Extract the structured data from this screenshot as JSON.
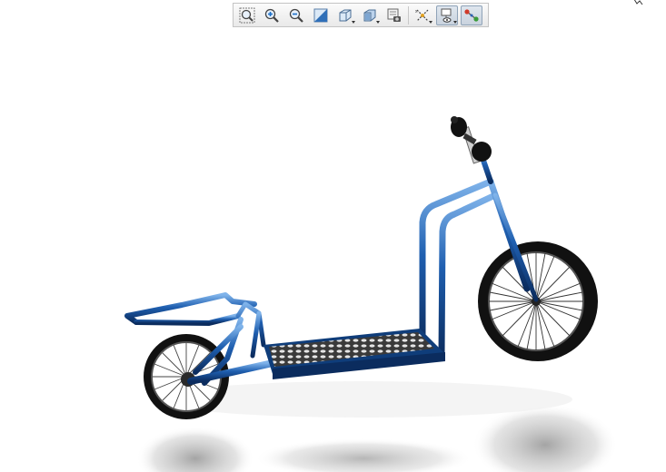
{
  "toolbar": {
    "buttons": [
      {
        "name": "zoom-to-fit",
        "icon": "zoom-fit-icon"
      },
      {
        "name": "zoom-in",
        "icon": "zoom-in-icon"
      },
      {
        "name": "zoom-out",
        "icon": "zoom-out-icon"
      },
      {
        "name": "section-view",
        "icon": "section-view-icon"
      },
      {
        "name": "view-orientation",
        "icon": "view-cube-icon"
      },
      {
        "name": "display-style",
        "icon": "display-style-icon"
      },
      {
        "name": "scene-settings",
        "icon": "camera-scene-icon"
      },
      {
        "name": "hide-show-items",
        "icon": "hide-show-icon"
      },
      {
        "name": "appearance",
        "icon": "appearance-icon",
        "active": true
      },
      {
        "name": "view-setting",
        "icon": "link-view-icon",
        "active": true
      }
    ]
  },
  "colors": {
    "frame_blue": "#1f5fb0",
    "frame_dark": "#0b2c5e",
    "tire": "#111111",
    "deck": "#d9d9d9"
  }
}
